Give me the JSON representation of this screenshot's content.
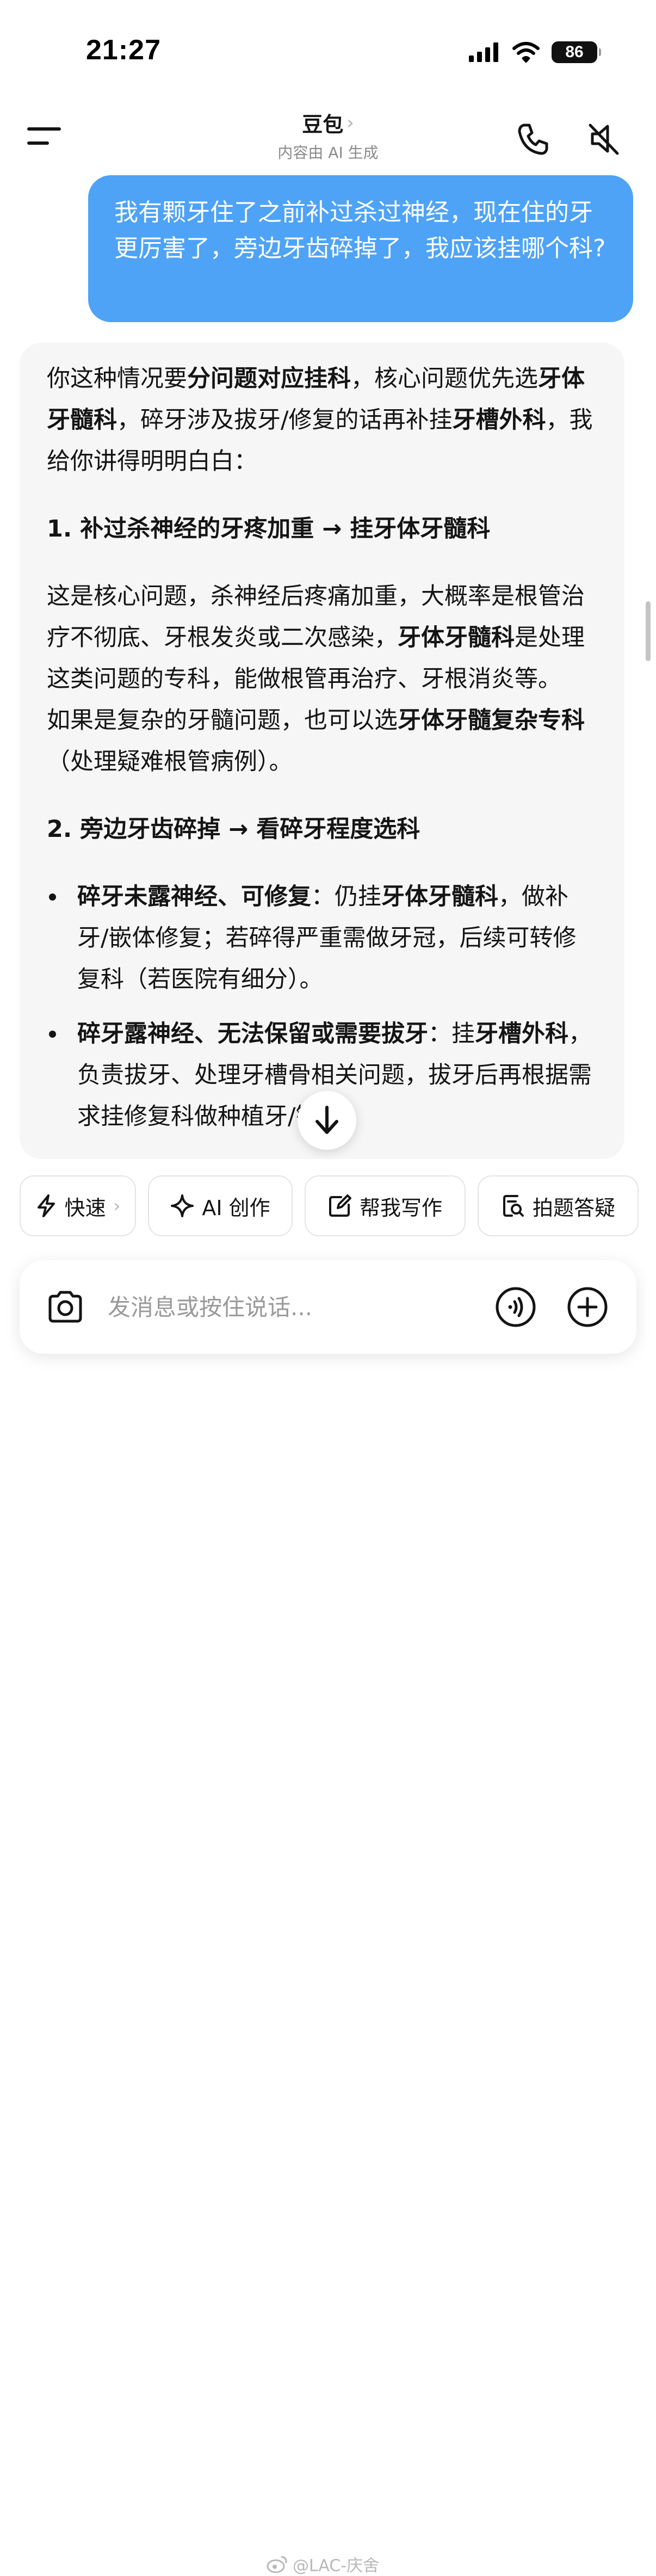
{
  "status_bar": {
    "time": "21:27",
    "battery": "86"
  },
  "header": {
    "title": "豆包",
    "title_chevron": "›",
    "subtitle": "内容由 AI 生成",
    "icons": [
      "menu-icon",
      "phone-icon",
      "speaker-muted-icon"
    ]
  },
  "user_message": "我有颗牙住了之前补过杀过神经，现在住的牙更厉害了，旁边牙齿碎掉了，我应该挂哪个科?",
  "ai_response": {
    "intro": {
      "t1": "你这种情况要",
      "b1": "分问题对应挂科",
      "t2": "，核心问题优先选",
      "b2": "牙体牙髓科",
      "t3": "，碎牙涉及拔牙/修复的话再补挂",
      "b3": "牙槽外科",
      "t4": "，我给你讲得明明白白："
    },
    "section1": {
      "heading": "1. 补过杀神经的牙疼加重 → 挂牙体牙髓科",
      "p1_t1": "这是核心问题，杀神经后疼痛加重，大概率是根管治疗不彻底、牙根发炎或二次感染，",
      "p1_b1": "牙体牙髓科",
      "p1_t2": "是处理这类问题的专科，能做根管再治疗、牙根消炎等。",
      "p2_t1": "如果是复杂的牙髓问题，也可以选",
      "p2_b1": "牙体牙髓复杂专科",
      "p2_t2": "（处理疑难根管病例）。"
    },
    "section2": {
      "heading": "2. 旁边牙齿碎掉 → 看碎牙程度选科",
      "bullet1": {
        "b1": "碎牙未露神经、可修复",
        "t1": "：仍挂",
        "b2": "牙体牙髓科",
        "t2": "，做补牙/嵌体修复；若碎得严重需做牙冠，后续可转修复科（若医院有细分）。"
      },
      "bullet2": {
        "b1": "碎牙露神经、无法保留或需要拔牙",
        "t1": "：挂",
        "b2": "牙槽外科",
        "t2": "，负责拔牙、处理牙槽骨相关问题，拔牙后再根据需求挂修复科做种植牙/镶牙。"
      }
    }
  },
  "scroll_down_icon": "arrow-down-icon",
  "quick_actions": [
    {
      "label": "快速",
      "icon": "lightning-icon",
      "chevron": "›"
    },
    {
      "label": "AI 创作",
      "icon": "sparkle-icon"
    },
    {
      "label": "帮我写作",
      "icon": "edit-icon"
    },
    {
      "label": "拍题答疑",
      "icon": "scan-question-icon"
    }
  ],
  "input": {
    "placeholder": "发消息或按住说话..."
  },
  "watermark": "@LAC-庆舍",
  "colors": {
    "user_bubble": "#4ea3f7",
    "ai_card": "#f6f6f6",
    "text": "#141414",
    "muted": "#8a8a8a"
  }
}
